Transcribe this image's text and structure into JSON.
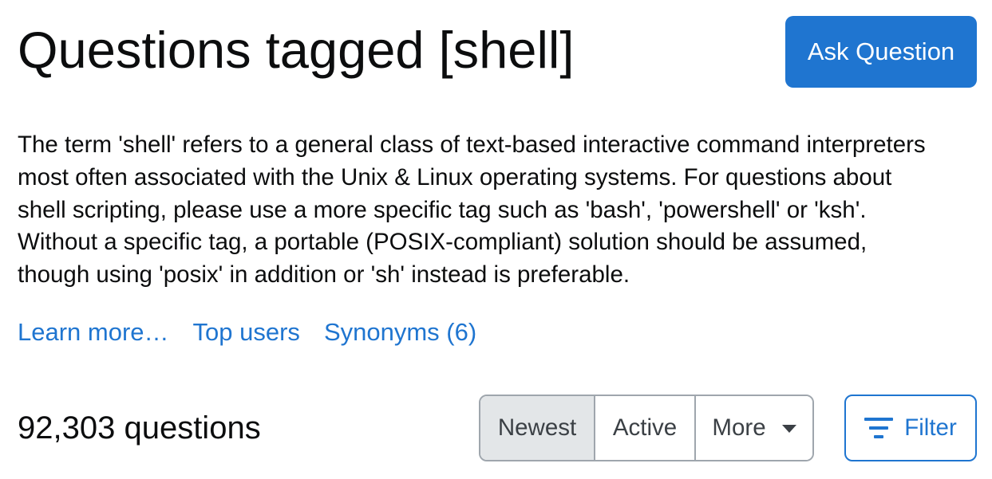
{
  "header": {
    "title": "Questions tagged [shell]",
    "ask_button_label": "Ask Question"
  },
  "tag": {
    "description": "The term 'shell' refers to a general class of text-based interactive command interpreters most often associated with the Unix & Linux operating systems. For questions about shell scripting, please use a more specific tag such as 'bash', 'powershell' or 'ksh'. Without a specific tag, a portable (POSIX-compliant) solution should be assumed, though using 'posix' in addition or 'sh' instead is preferable.",
    "links": {
      "learn_more": "Learn more…",
      "top_users": "Top users",
      "synonyms": "Synonyms (6)"
    }
  },
  "list": {
    "count_label": "92,303 questions",
    "sort_tabs": {
      "newest": "Newest",
      "active": "Active",
      "more": "More"
    },
    "selected_sort": "Newest",
    "filter_label": "Filter"
  },
  "icons": {
    "filter": "filter-icon",
    "more": "chevron-down-icon"
  },
  "colors": {
    "accent": "#1f75d0",
    "selected_tab_bg": "#e3e6e8",
    "border": "#9fa6ad",
    "text": "#0c0d0e"
  }
}
